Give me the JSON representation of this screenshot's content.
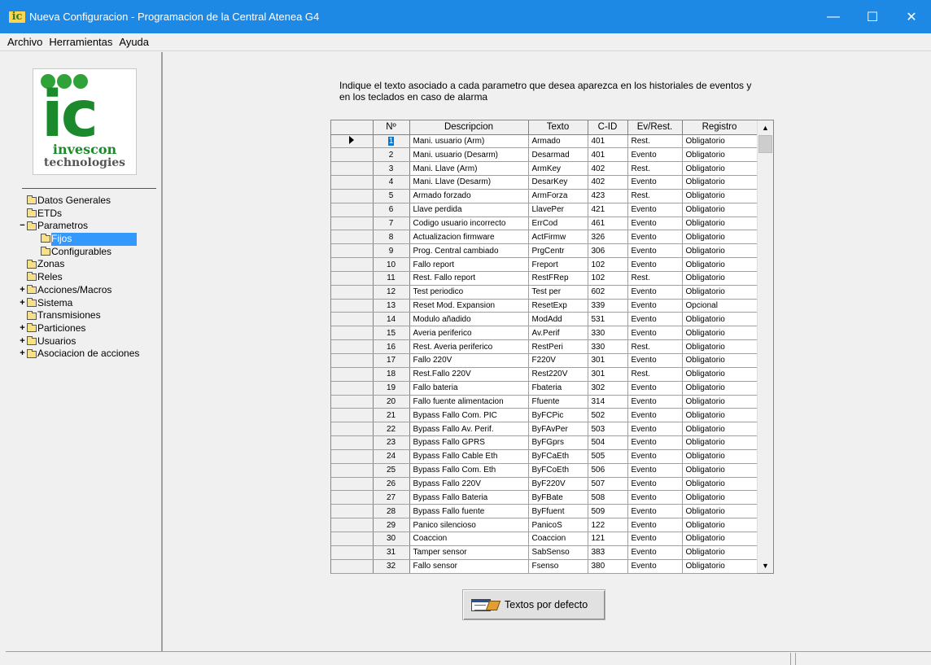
{
  "window": {
    "title": "Nueva Configuracion - Programacion de la Central Atenea G4",
    "app_icon": "ic",
    "minimize": "—",
    "maximize": "☐",
    "close": "✕"
  },
  "menu": {
    "items": [
      "Archivo",
      "Herramientas",
      "Ayuda"
    ]
  },
  "logo": {
    "mark": "ic",
    "brand": "invescon",
    "tagline": "technologies"
  },
  "tree": {
    "items": [
      {
        "label": "Datos Generales",
        "level": 0,
        "expander": ""
      },
      {
        "label": "ETDs",
        "level": 0,
        "expander": ""
      },
      {
        "label": "Parametros",
        "level": 0,
        "expander": "−"
      },
      {
        "label": "Fijos",
        "level": 1,
        "expander": "",
        "selected": true
      },
      {
        "label": "Configurables",
        "level": 1,
        "expander": ""
      },
      {
        "label": "Zonas",
        "level": 0,
        "expander": ""
      },
      {
        "label": "Reles",
        "level": 0,
        "expander": ""
      },
      {
        "label": "Acciones/Macros",
        "level": 0,
        "expander": "+"
      },
      {
        "label": "Sistema",
        "level": 0,
        "expander": "+"
      },
      {
        "label": "Transmisiones",
        "level": 0,
        "expander": ""
      },
      {
        "label": "Particiones",
        "level": 0,
        "expander": "+"
      },
      {
        "label": "Usuarios",
        "level": 0,
        "expander": "+"
      },
      {
        "label": "Asociacion de acciones",
        "level": 0,
        "expander": "+"
      }
    ]
  },
  "main": {
    "instruction_line1": "Indique el texto asociado a cada parametro que desea aparezca en los historiales de eventos y",
    "instruction_line2": "en los teclados en caso de alarma",
    "default_button": "Textos por defecto"
  },
  "grid": {
    "columns": [
      "Nº",
      "Descripcion",
      "Texto",
      "C-ID",
      "Ev/Rest.",
      "Registro"
    ],
    "rows": [
      [
        "1",
        "Mani. usuario  (Arm)",
        "Armado",
        "401",
        "Rest.",
        "Obligatorio"
      ],
      [
        "2",
        "Mani. usuario  (Desarm)",
        "Desarmad",
        "401",
        "Evento",
        "Obligatorio"
      ],
      [
        "3",
        "Mani. Llave  (Arm)",
        "ArmKey",
        "402",
        "Rest.",
        "Obligatorio"
      ],
      [
        "4",
        "Mani. Llave  (Desarm)",
        "DesarKey",
        "402",
        "Evento",
        "Obligatorio"
      ],
      [
        "5",
        "Armado forzado",
        "ArmForza",
        "423",
        "Rest.",
        "Obligatorio"
      ],
      [
        "6",
        "Llave perdida",
        "LlavePer",
        "421",
        "Evento",
        "Obligatorio"
      ],
      [
        "7",
        "Codigo usuario incorrecto",
        "ErrCod",
        "461",
        "Evento",
        "Obligatorio"
      ],
      [
        "8",
        "Actualizacion firmware",
        "ActFirmw",
        "326",
        "Evento",
        "Obligatorio"
      ],
      [
        "9",
        "Prog. Central cambiado",
        "PrgCentr",
        "306",
        "Evento",
        "Obligatorio"
      ],
      [
        "10",
        "Fallo report",
        "Freport",
        "102",
        "Evento",
        "Obligatorio"
      ],
      [
        "11",
        "Rest. Fallo report",
        "RestFRep",
        "102",
        "Rest.",
        "Obligatorio"
      ],
      [
        "12",
        "Test periodico",
        "Test per",
        "602",
        "Evento",
        "Obligatorio"
      ],
      [
        "13",
        "Reset Mod.  Expansion",
        "ResetExp",
        "339",
        "Evento",
        "Opcional"
      ],
      [
        "14",
        "Modulo añadido",
        "ModAdd",
        "531",
        "Evento",
        "Obligatorio"
      ],
      [
        "15",
        "Averia periferico",
        "Av.Perif",
        "330",
        "Evento",
        "Obligatorio"
      ],
      [
        "16",
        "Rest.  Averia periferico",
        "RestPeri",
        "330",
        "Rest.",
        "Obligatorio"
      ],
      [
        "17",
        "Fallo 220V",
        "F220V",
        "301",
        "Evento",
        "Obligatorio"
      ],
      [
        "18",
        "Rest.Fallo 220V",
        "Rest220V",
        "301",
        "Rest.",
        "Obligatorio"
      ],
      [
        "19",
        "Fallo bateria",
        "Fbateria",
        "302",
        "Evento",
        "Obligatorio"
      ],
      [
        "20",
        "Fallo fuente alimentacion",
        "Ffuente",
        "314",
        "Evento",
        "Obligatorio"
      ],
      [
        "21",
        "Bypass Fallo Com. PIC",
        "ByFCPic",
        "502",
        "Evento",
        "Obligatorio"
      ],
      [
        "22",
        "Bypass Fallo Av. Perif.",
        "ByFAvPer",
        "503",
        "Evento",
        "Obligatorio"
      ],
      [
        "23",
        "Bypass Fallo GPRS",
        "ByFGprs",
        "504",
        "Evento",
        "Obligatorio"
      ],
      [
        "24",
        "Bypass Fallo Cable Eth",
        "ByFCaEth",
        "505",
        "Evento",
        "Obligatorio"
      ],
      [
        "25",
        "Bypass Fallo Com. Eth",
        "ByFCoEth",
        "506",
        "Evento",
        "Obligatorio"
      ],
      [
        "26",
        "Bypass Fallo 220V",
        "ByF220V",
        "507",
        "Evento",
        "Obligatorio"
      ],
      [
        "27",
        "Bypass Fallo Bateria",
        "ByFBate",
        "508",
        "Evento",
        "Obligatorio"
      ],
      [
        "28",
        "Bypass Fallo fuente",
        "ByFfuent",
        "509",
        "Evento",
        "Obligatorio"
      ],
      [
        "29",
        "Panico silencioso",
        "PanicoS",
        "122",
        "Evento",
        "Obligatorio"
      ],
      [
        "30",
        "Coaccion",
        "Coaccion",
        "121",
        "Evento",
        "Obligatorio"
      ],
      [
        "31",
        "Tamper sensor",
        "SabSenso",
        "383",
        "Evento",
        "Obligatorio"
      ],
      [
        "32",
        "Fallo sensor",
        "Fsenso",
        "380",
        "Evento",
        "Obligatorio"
      ]
    ],
    "current_row": 0,
    "scroll_up": "▲",
    "scroll_down": "▼"
  }
}
